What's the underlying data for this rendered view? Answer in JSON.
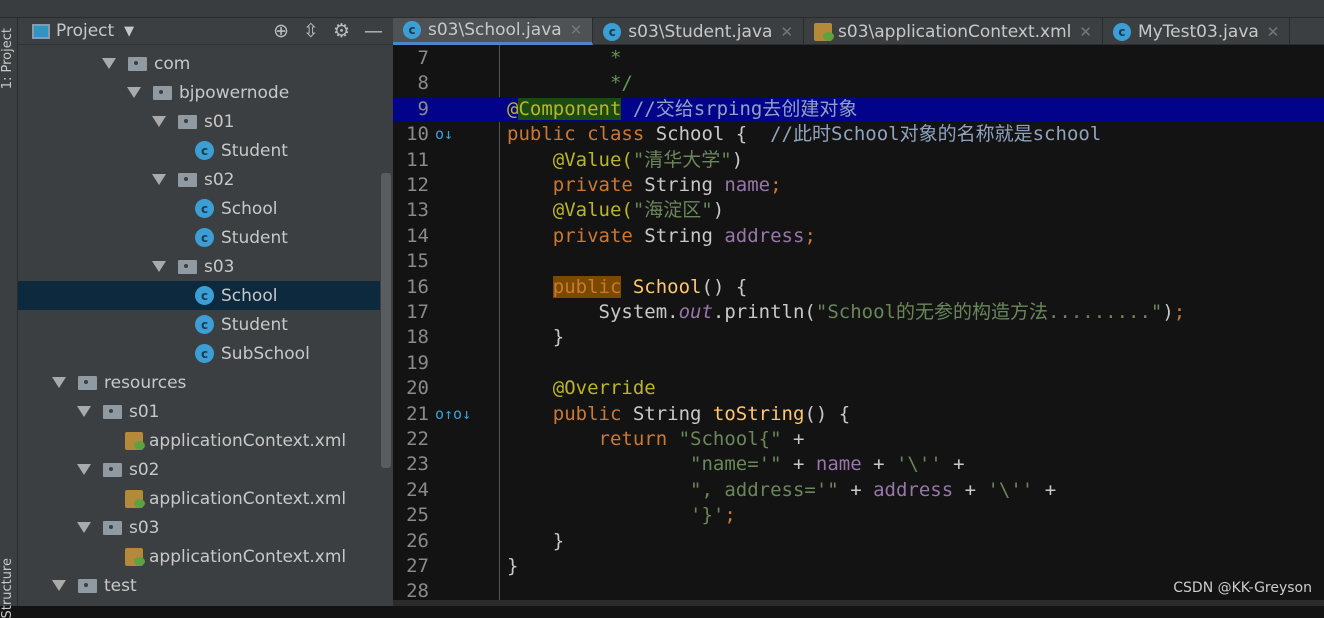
{
  "sidebar": {
    "title": "Project",
    "strip_top": "1: Project",
    "strip_bottom": "Structure",
    "items": [
      {
        "label": "com",
        "type": "folder",
        "depth": 4
      },
      {
        "label": "bjpowernode",
        "type": "folder",
        "depth": 5
      },
      {
        "label": "s01",
        "type": "folder",
        "depth": 6
      },
      {
        "label": "Student",
        "type": "class",
        "depth": 7
      },
      {
        "label": "s02",
        "type": "folder",
        "depth": 6
      },
      {
        "label": "School",
        "type": "class",
        "depth": 7
      },
      {
        "label": "Student",
        "type": "class",
        "depth": 7
      },
      {
        "label": "s03",
        "type": "folder",
        "depth": 6
      },
      {
        "label": "School",
        "type": "class",
        "depth": 7,
        "selected": true
      },
      {
        "label": "Student",
        "type": "class",
        "depth": 7
      },
      {
        "label": "SubSchool",
        "type": "class",
        "depth": 7
      },
      {
        "label": "resources",
        "type": "resfolder",
        "depth": 2
      },
      {
        "label": "s01",
        "type": "folder",
        "depth": 3
      },
      {
        "label": "applicationContext.xml",
        "type": "xml",
        "depth": 4
      },
      {
        "label": "s02",
        "type": "folder",
        "depth": 3
      },
      {
        "label": "applicationContext.xml",
        "type": "xml",
        "depth": 4
      },
      {
        "label": "s03",
        "type": "folder",
        "depth": 3
      },
      {
        "label": "applicationContext.xml",
        "type": "xml",
        "depth": 4
      },
      {
        "label": "test",
        "type": "folder",
        "depth": 2
      }
    ]
  },
  "tabs": [
    {
      "label": "s03\\School.java",
      "icon": "class",
      "active": true
    },
    {
      "label": "s03\\Student.java",
      "icon": "class"
    },
    {
      "label": "s03\\applicationContext.xml",
      "icon": "xml"
    },
    {
      "label": "MyTest03.java",
      "icon": "class"
    }
  ],
  "editor": {
    "lines": [
      {
        "n": "7",
        "t": [
          [
            "         *",
            "doc"
          ]
        ]
      },
      {
        "n": "8",
        "t": [
          [
            "         */",
            "doc"
          ]
        ]
      },
      {
        "n": "9",
        "hl": true,
        "t": [
          [
            "@",
            "ann"
          ],
          [
            "Component",
            "annhl"
          ],
          [
            " //交给srping去创建对象",
            "cm"
          ]
        ]
      },
      {
        "n": "10",
        "g": "o↓",
        "t": [
          [
            "public class ",
            "kw"
          ],
          [
            "School { ",
            ""
          ],
          [
            " //此时School对象的名称就是school",
            "cm"
          ]
        ]
      },
      {
        "n": "11",
        "t": [
          [
            "    @Value(",
            "ann"
          ],
          [
            "\"清华大学\"",
            "str"
          ],
          [
            ")",
            ""
          ]
        ]
      },
      {
        "n": "12",
        "t": [
          [
            "    private ",
            "kw"
          ],
          [
            "String ",
            ""
          ],
          [
            "name",
            "fld"
          ],
          [
            ";",
            "kw"
          ]
        ]
      },
      {
        "n": "13",
        "t": [
          [
            "    @Value(",
            "ann"
          ],
          [
            "\"海淀区\"",
            "str"
          ],
          [
            ")",
            ""
          ]
        ]
      },
      {
        "n": "14",
        "t": [
          [
            "    private ",
            "kw"
          ],
          [
            "String ",
            ""
          ],
          [
            "address",
            "fld"
          ],
          [
            ";",
            "kw"
          ]
        ]
      },
      {
        "n": "15",
        "t": []
      },
      {
        "n": "16",
        "t": [
          [
            "    ",
            ""
          ],
          [
            "public",
            "kwhl"
          ],
          [
            " ",
            ""
          ],
          [
            "School",
            "mth"
          ],
          [
            "() {",
            ""
          ]
        ]
      },
      {
        "n": "17",
        "t": [
          [
            "        System.",
            ""
          ],
          [
            "out",
            "it"
          ],
          [
            ".println(",
            ""
          ],
          [
            "\"School的无参的构造方法.........\"",
            "str"
          ],
          [
            ")",
            ""
          ],
          [
            ";",
            "kw"
          ]
        ]
      },
      {
        "n": "18",
        "t": [
          [
            "    }",
            ""
          ]
        ]
      },
      {
        "n": "19",
        "t": []
      },
      {
        "n": "20",
        "t": [
          [
            "    @Override",
            "ann"
          ]
        ]
      },
      {
        "n": "21",
        "g": "o↑o↓",
        "t": [
          [
            "    public ",
            "kw"
          ],
          [
            "String ",
            ""
          ],
          [
            "toString",
            "mth"
          ],
          [
            "() {",
            ""
          ]
        ]
      },
      {
        "n": "22",
        "t": [
          [
            "        return ",
            "kw"
          ],
          [
            "\"School{\"",
            "str"
          ],
          [
            " +",
            ""
          ]
        ]
      },
      {
        "n": "23",
        "t": [
          [
            "                ",
            ""
          ],
          [
            "\"name='\"",
            "str"
          ],
          [
            " + ",
            ""
          ],
          [
            "name",
            "fld"
          ],
          [
            " + ",
            ""
          ],
          [
            "'\\''",
            "str"
          ],
          [
            " +",
            ""
          ]
        ]
      },
      {
        "n": "24",
        "t": [
          [
            "                ",
            ""
          ],
          [
            "\", address='\"",
            "str"
          ],
          [
            " + ",
            ""
          ],
          [
            "address",
            "fld"
          ],
          [
            " + ",
            ""
          ],
          [
            "'\\''",
            "str"
          ],
          [
            " +",
            ""
          ]
        ]
      },
      {
        "n": "25",
        "t": [
          [
            "                ",
            ""
          ],
          [
            "'}'",
            "str"
          ],
          [
            ";",
            "kw"
          ]
        ]
      },
      {
        "n": "26",
        "t": [
          [
            "    }",
            ""
          ]
        ]
      },
      {
        "n": "27",
        "t": [
          [
            "}",
            ""
          ]
        ]
      },
      {
        "n": "28",
        "t": []
      }
    ]
  },
  "watermark": "CSDN @KK-Greyson"
}
